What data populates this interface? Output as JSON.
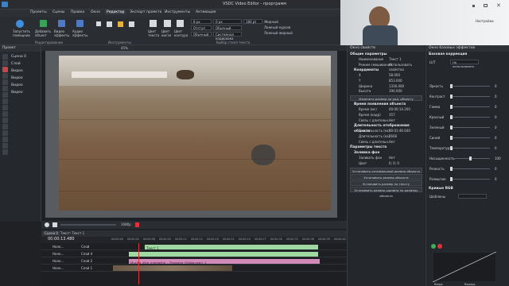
{
  "window": {
    "title": "VSDC Video Editor - прорграмм"
  },
  "menu": [
    "Проекты",
    "Сцены",
    "Правка",
    "Окно",
    "Редактор",
    "Экспорт проекта",
    "Инструменты",
    "Активация"
  ],
  "menu_active": "Редактор",
  "ribbon": {
    "run_wizard": "Запустить помощник",
    "add_object": "Добавить объект",
    "video_effects": "Видео эффекты",
    "audio_effects": "Аудио эффекты",
    "editing_group": "Редактирование",
    "tools_group": "Инструменты",
    "text_color": "Цвет текста",
    "fill_color": "Цвет кисти",
    "contour_color": "Цвет контура",
    "font_name": "Arial",
    "font_size": "184 pt",
    "style_none": "Стиль",
    "text_styles": "Выбор стиля текста",
    "bold": "Жирный",
    "italic": "Ложный курсив",
    "underline": "Ложный жирный",
    "settings": "Настройки",
    "normal": "Обычный",
    "system_default": "Системная кодировка",
    "spacing": "Отступ",
    "size_a": "8 px",
    "size_b": "0 px"
  },
  "left_panel": {
    "header": "Проект",
    "scene": "Сцена 0",
    "layers": [
      "Слой",
      "Видео",
      "Видео",
      "Видео",
      "Видео"
    ]
  },
  "preview": {
    "zoom": "45%"
  },
  "playbar": {
    "speed": "1080p"
  },
  "timeline": {
    "tabs": [
      "Сцена 0",
      "Текст: Текст 1"
    ],
    "time": "00:00:13.480",
    "tracks": [
      {
        "name": "Нало...",
        "layer": "Слой",
        "clip": "Текст 1"
      },
      {
        "name": "Нало...",
        "layer": "Слой 4",
        "clip": ""
      },
      {
        "name": "Нало...",
        "layer": "Слой 2",
        "clip": "Muzika_dlya_montazha_-_Finovaya_(Sytba.com)_1"
      },
      {
        "name": "Нало...",
        "layer": "Слой 1",
        "clip": ""
      }
    ],
    "ruler": [
      "00:00:00",
      "00:00:03",
      "00:00:06",
      "00:00:09",
      "00:00:12",
      "00:00:15",
      "00:00:18",
      "00:00:21",
      "00:00:24",
      "00:00:27",
      "00:00:30",
      "00:00:33",
      "00:00:36",
      "00:00:39",
      "00:00:42"
    ]
  },
  "properties": {
    "title": "Окно свойств",
    "general": "Общие параметры",
    "rows": [
      {
        "k": "Наименование",
        "v": "Текст 1"
      },
      {
        "k": "Режим смешивания",
        "v": "Использовать свойства"
      }
    ],
    "coords_title": "Координаты",
    "coords": [
      {
        "k": "X",
        "v": "58.000"
      },
      {
        "k": "Y",
        "v": "853.000"
      },
      {
        "k": "Ширина",
        "v": "1336.000"
      },
      {
        "k": "Высота",
        "v": "190.000"
      }
    ],
    "same_size": "Изменить размер по род. объекту",
    "time_title": "Время появления объекта",
    "time_rows": [
      {
        "k": "Время (мс)",
        "v": "00:00:14.200"
      },
      {
        "k": "Время (кадр)",
        "v": "357"
      },
      {
        "k": "Связь с длительн.",
        "v": "Нет"
      }
    ],
    "duration_title": "Длительность отображения объекта",
    "duration_rows": [
      {
        "k": "Длительность (мс)",
        "v": "00:01:46.640"
      },
      {
        "k": "Длительность (ка)",
        "v": "2666"
      },
      {
        "k": "Связь с длительн.",
        "v": "Нет"
      }
    ],
    "text_title": "Параметры текста",
    "fill_title": "Заливка фон",
    "fill_rows": [
      {
        "k": "Заливать фон",
        "v": "Нет"
      },
      {
        "k": "Цвет",
        "v": "0; 0; 0"
      }
    ],
    "buttons": [
      "Установить оптимальный размер объекта",
      "Установить размер объекта",
      "Установить размер по тексту",
      "Установить размер шрифта по размеру объекта"
    ]
  },
  "effects": {
    "title": "Окно базовых эффектов",
    "section": "Базовая коррекция",
    "lut": "LUT",
    "lut_value": "Не использовать",
    "sliders": [
      {
        "name": "Яркость",
        "v": "0"
      },
      {
        "name": "Контраст",
        "v": "0"
      },
      {
        "name": "Гамма",
        "v": "0"
      },
      {
        "name": "Красный",
        "v": "0"
      },
      {
        "name": "Зеленый",
        "v": "0"
      },
      {
        "name": "Синий",
        "v": "0"
      },
      {
        "name": "Температура",
        "v": "0"
      },
      {
        "name": "Насыщенность",
        "v": "100"
      },
      {
        "name": "Резкость",
        "v": "0"
      },
      {
        "name": "Размытие",
        "v": "0"
      }
    ],
    "curves": "Кривые RGB",
    "templates": "Шаблоны",
    "curve_axis": [
      "0",
      "128",
      "255"
    ],
    "in_label": "Вход:",
    "out_label": "Выход:"
  },
  "colors": {
    "accent": "#2f7fd8",
    "green_clip": "#9fd8a0",
    "pink_clip": "#d08ab8",
    "playhead": "#e0303a"
  }
}
